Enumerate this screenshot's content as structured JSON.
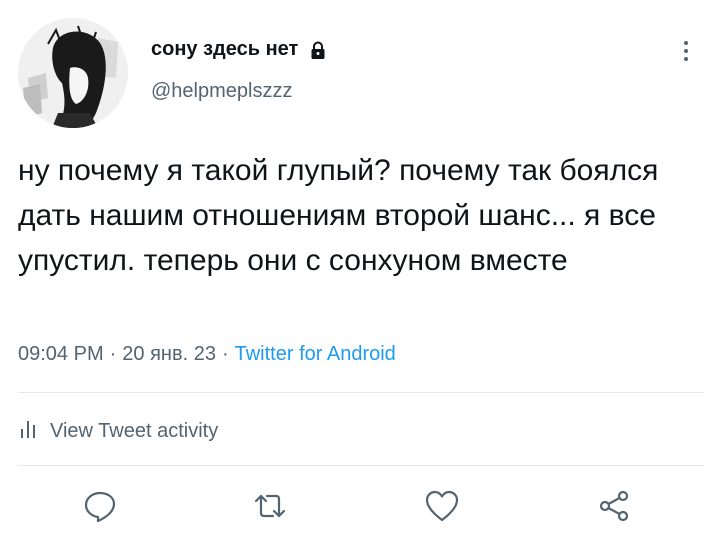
{
  "tweet": {
    "display_name": "сону здесь нет",
    "username": "@helpmeplszzz",
    "text": "ну почему я такой глупый? почему так боялся дать нашим отношениям второй шанс... я все упустил. теперь они с сонхуном вместе",
    "time": "09:04 PM",
    "date": "20 янв. 23",
    "separator": "·",
    "source": "Twitter for Android",
    "activity_label": "View Tweet activity"
  },
  "icons": {
    "lock": "lock-icon",
    "more": "more-vertical-icon",
    "analytics": "analytics-icon",
    "reply": "reply-icon",
    "retweet": "retweet-icon",
    "like": "like-icon",
    "share": "share-icon"
  },
  "colors": {
    "text_primary": "#0f1419",
    "text_secondary": "#536471",
    "link": "#1d9bf0",
    "divider": "#e6e9ec"
  }
}
